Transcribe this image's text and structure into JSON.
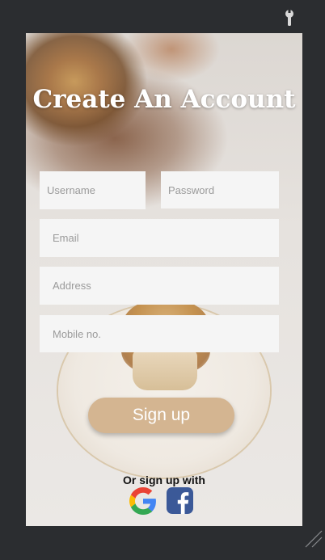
{
  "page": {
    "title": "Create An Account"
  },
  "form": {
    "username": {
      "placeholder": "Username",
      "value": ""
    },
    "password": {
      "placeholder": "Password",
      "value": ""
    },
    "email": {
      "placeholder": "Email",
      "value": ""
    },
    "address": {
      "placeholder": "Address",
      "value": ""
    },
    "mobile": {
      "placeholder": "Mobile no.",
      "value": ""
    }
  },
  "actions": {
    "signup_label": "Sign up",
    "social_label": "Or sign up with"
  },
  "icons": {
    "toolbar": "wrench-icon",
    "social": [
      "google-icon",
      "facebook-icon"
    ],
    "window": "resize-grip-icon"
  },
  "colors": {
    "frame_background": "#2b2d30",
    "button": "#d4b591",
    "field_background": "#f5f5f5",
    "title": "#ffffff",
    "facebook": "#3b5998"
  }
}
